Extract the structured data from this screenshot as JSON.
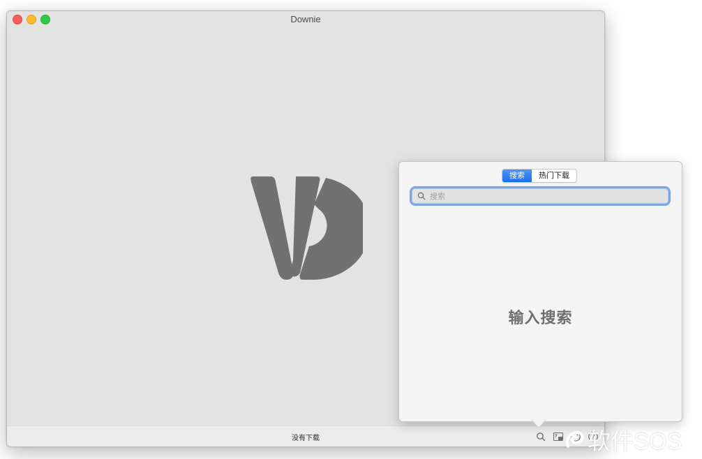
{
  "window": {
    "title": "Downie",
    "traffic_lights": {
      "close": "close-button",
      "minimize": "minimize-button",
      "zoom": "zoom-button"
    }
  },
  "main": {
    "logo": "downie-logo",
    "logo_color": "#717171"
  },
  "bottom_bar": {
    "status_text": "没有下载",
    "icons": [
      "search-icon",
      "photos-icon",
      "speed-icon",
      "help-icon"
    ]
  },
  "popover": {
    "tabs": [
      {
        "label": "搜索",
        "active": true
      },
      {
        "label": "热门下载",
        "active": false
      }
    ],
    "search": {
      "value": "",
      "placeholder": "搜索"
    },
    "empty_state": "输入搜索",
    "accent_color": "#1d6fe8"
  },
  "watermark": {
    "text": "软件SOS"
  }
}
